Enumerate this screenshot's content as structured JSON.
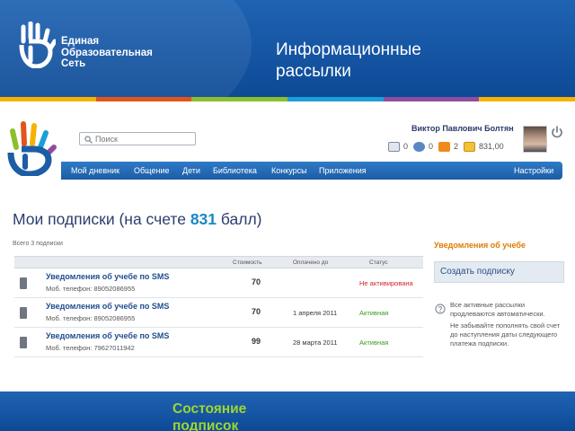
{
  "slide": {
    "logo_lines": [
      "Единая",
      "Образовательная",
      "Сеть"
    ],
    "title_lines": [
      "Информационные",
      "рассылки"
    ],
    "caption_lines": [
      "Состояние",
      "подписок"
    ],
    "stripe_colors": [
      "#f7b200",
      "#e2541b",
      "#8bbf2d",
      "#1c9fd8",
      "#8d4ea2",
      "#f7b200"
    ]
  },
  "site": {
    "search_placeholder": "Поиск",
    "user_name": "Виктор Павлович Болтян",
    "counters": [
      {
        "icon": "mail-icon",
        "value": "0"
      },
      {
        "icon": "friends-icon",
        "value": "0"
      },
      {
        "icon": "notifications-icon",
        "value": "2"
      },
      {
        "icon": "points-icon",
        "value": "831,00"
      }
    ],
    "nav": [
      "Мой дневник",
      "Общение",
      "Дети",
      "Библиотека",
      "Конкурсы",
      "Приложения"
    ],
    "settings": "Настройки",
    "page_title_prefix": "Мои подписки (на счете ",
    "page_title_points": "831",
    "page_title_suffix": " балл)",
    "subs_count": "Всего 3 подписки",
    "table": {
      "headers": [
        "Стоимость",
        "Оплачено до",
        "Статус"
      ],
      "rows": [
        {
          "title": "Уведомления об учебе по SMS",
          "phone": "Моб. телефон: 89052086955",
          "cost": "70",
          "paid_until": "",
          "status": "Не активирована",
          "status_kind": "inactive"
        },
        {
          "title": "Уведомления об учебе по SMS",
          "phone": "Моб. телефон: 89052086955",
          "cost": "70",
          "paid_until": "1 апреля 2011",
          "status": "Активная",
          "status_kind": "active"
        },
        {
          "title": "Уведомления об учебе по SMS",
          "phone": "Моб. телефон: 79627011942",
          "cost": "99",
          "paid_until": "28 марта 2011",
          "status": "Активная",
          "status_kind": "active"
        }
      ]
    },
    "sidebar": {
      "header": "Уведомления об учебе",
      "create_button": "Создать подписку",
      "info": [
        "Все активные рассылки продлеваются автоматически.",
        "Не забывайте пополнять свой счет до наступления даты следующего платежа подписки."
      ]
    }
  }
}
